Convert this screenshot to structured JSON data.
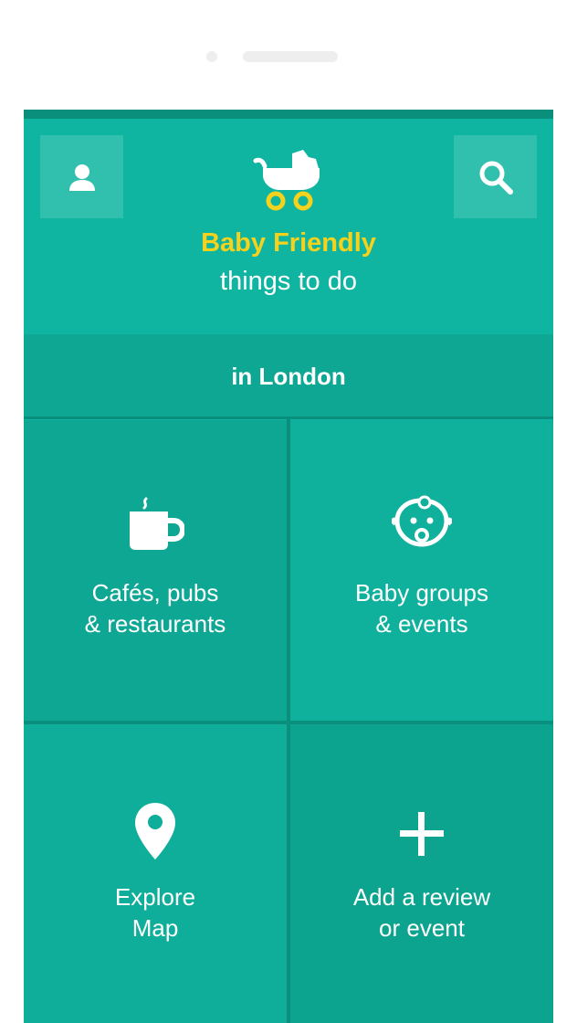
{
  "app": {
    "brand_title": "Baby Friendly",
    "brand_subtitle": "things to do",
    "location_label": "in London"
  },
  "colors": {
    "primary": "#0fb5a0",
    "primary_dark": "#0b8f7d",
    "tile": "#0ea794",
    "accent": "#f6d21c",
    "text": "#ffffff"
  },
  "header": {
    "left_icon": "user-icon",
    "right_icon": "search-icon",
    "logo_icon": "pram-icon"
  },
  "tiles": [
    {
      "icon": "coffee-cup-icon",
      "line1": "Cafés, pubs",
      "line2": "& restaurants"
    },
    {
      "icon": "baby-face-icon",
      "line1": "Baby groups",
      "line2": "& events"
    },
    {
      "icon": "map-pin-icon",
      "line1": "Explore",
      "line2": "Map"
    },
    {
      "icon": "plus-icon",
      "line1": "Add a review",
      "line2": "or event"
    }
  ]
}
